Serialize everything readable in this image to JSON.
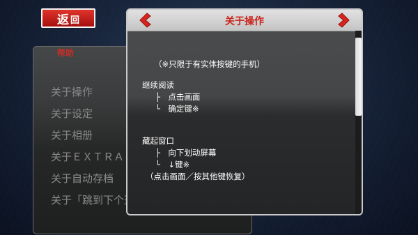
{
  "back_button": {
    "label_main": "返",
    "label_sub": "回"
  },
  "menu": {
    "title": "帮助",
    "items": [
      "关于操作",
      "关于设定",
      "关于相册",
      "关于ＥＸＴＲＡ",
      "关于自动存档",
      "关于「跳到下个选项」"
    ]
  },
  "dialog": {
    "title": "关于操作",
    "note": "（※只限于有实体按键的手机）",
    "section1": {
      "heading": "继续阅读",
      "item1": "├　点击画面",
      "item2": "└　确定键※"
    },
    "section2": {
      "heading": "藏起窗口",
      "item1": "├　向下划动屏幕",
      "item2": "└　↓键※",
      "note": "（点击画面／按其他键恢复）"
    }
  },
  "icons": {
    "prev": "chevron-left-icon",
    "next": "chevron-right-icon"
  },
  "colors": {
    "accent_red": "#c9251f",
    "button_red": "#d0231c"
  }
}
